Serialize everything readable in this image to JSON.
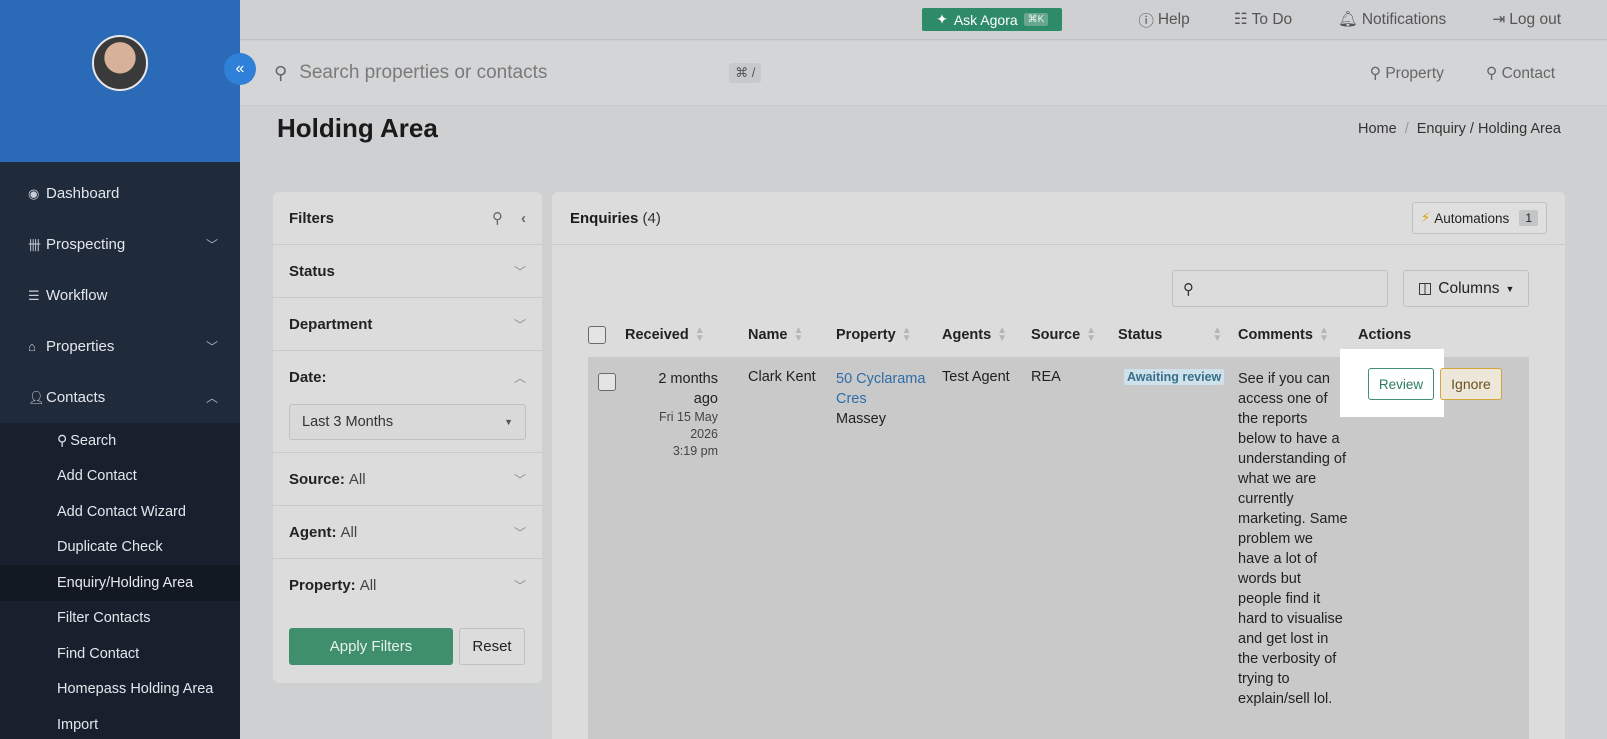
{
  "topbar": {
    "ask_label": "Ask Agora",
    "ask_kbd": "⌘K",
    "help": "Help",
    "todo": "To Do",
    "notifications": "Notifications",
    "logout": "Log out"
  },
  "search": {
    "placeholder": "Search properties or contacts",
    "shortcut": "⌘ /",
    "property_link": "Property",
    "contact_link": "Contact"
  },
  "sidebar": {
    "items": [
      {
        "label": "Dashboard",
        "icon": "dashboard-icon"
      },
      {
        "label": "Prospecting",
        "icon": "prospecting-icon"
      },
      {
        "label": "Workflow",
        "icon": "workflow-icon"
      },
      {
        "label": "Properties",
        "icon": "home-icon"
      },
      {
        "label": "Contacts",
        "icon": "user-icon"
      }
    ],
    "contacts_sub": [
      "Search",
      "Add Contact",
      "Add Contact Wizard",
      "Duplicate Check",
      "Enquiry/Holding Area",
      "Filter Contacts",
      "Find Contact",
      "Homepass Holding Area",
      "Import"
    ]
  },
  "page": {
    "title": "Holding Area",
    "breadcrumb_home": "Home",
    "breadcrumb_sep": "/",
    "breadcrumb_current": "Enquiry / Holding Area"
  },
  "filters": {
    "title": "Filters",
    "status": "Status",
    "department": "Department",
    "date": "Date:",
    "date_value": "Last 3 Months",
    "source": "Source:",
    "source_value": "All",
    "agent": "Agent:",
    "agent_value": "All",
    "property": "Property:",
    "property_value": "All",
    "apply": "Apply Filters",
    "reset": "Reset"
  },
  "enquiries": {
    "title": "Enquiries",
    "count": "(4)",
    "automations_label": "Automations",
    "automations_count": "1",
    "columns_label": "Columns",
    "headers": {
      "received": "Received",
      "name": "Name",
      "property": "Property",
      "agents": "Agents",
      "source": "Source",
      "status": "Status",
      "comments": "Comments",
      "actions": "Actions"
    },
    "row": {
      "received_rel_1": "2 months",
      "received_rel_2": "ago",
      "received_date_1": "Fri 15 May",
      "received_date_2": "2026",
      "received_time": "3:19 pm",
      "name": "Clark Kent",
      "property_line1": "50 Cyclarama",
      "property_line2": "Cres",
      "suburb": "Massey",
      "agent": "Test Agent",
      "source": "REA",
      "status": "Awaiting review",
      "comment": "See if you can access one of the reports below to have a understanding of what we are currently marketing. Same problem we have a lot of words but people find it hard to visualise and get lost in the verbosity of trying to explain/sell lol.",
      "review": "Review",
      "ignore": "Ignore"
    }
  }
}
